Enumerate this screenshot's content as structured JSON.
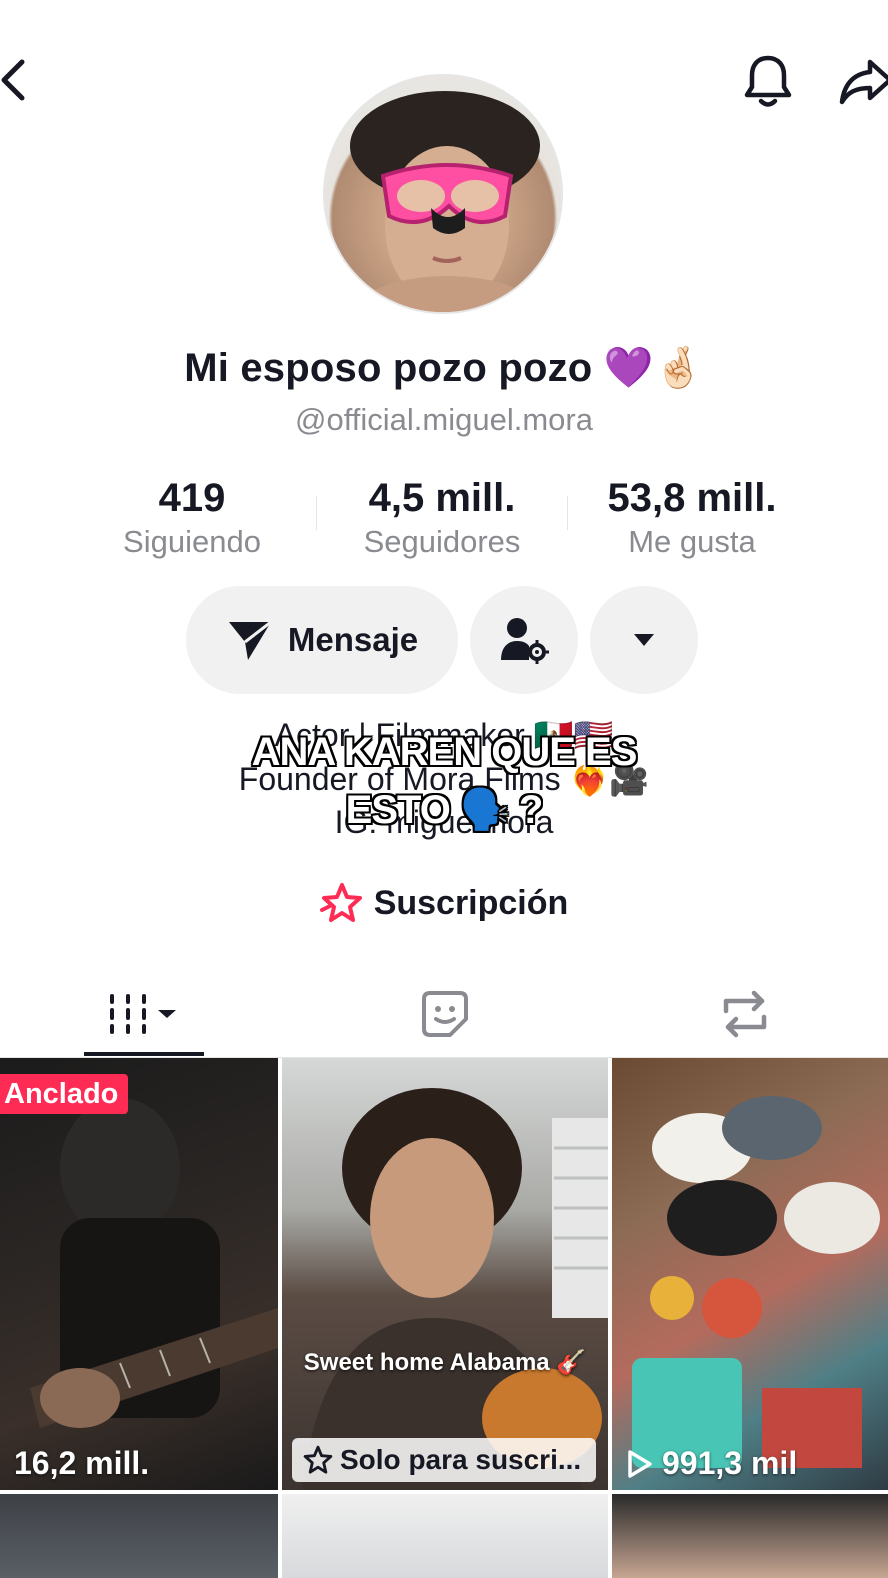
{
  "header": {
    "back_icon": "chevron-left-icon",
    "bell_icon": "bell-icon",
    "share_icon": "share-arrow-icon"
  },
  "profile": {
    "display_name": "Mi esposo pozo pozo 💜🤞🏻",
    "handle": "@official.miguel.mora"
  },
  "stats": [
    {
      "value": "419",
      "label": "Siguiendo"
    },
    {
      "value": "4,5 mill.",
      "label": "Seguidores"
    },
    {
      "value": "53,8 mill.",
      "label": "Me gusta"
    }
  ],
  "actions": {
    "message_label": "Mensaje",
    "message_icon": "send-icon",
    "friend_icon": "user-settings-icon",
    "more_icon": "caret-down-icon"
  },
  "bio": {
    "line1": "Actor | Filmmaker 🇲🇽🇺🇸",
    "line2": "Founder of Mora Films ❤️‍🔥🎥",
    "line3": "IG: miguelmora"
  },
  "caption_overlay": {
    "line1": "ANA KAREN QUE ES",
    "line2": "ESTO 🗣️ ?"
  },
  "subscription": {
    "label": "Suscripción",
    "icon": "star-outline-icon",
    "accent": "#fe2c55"
  },
  "tabs": [
    {
      "name": "videos",
      "icon": "grid-columns-icon"
    },
    {
      "name": "favorites",
      "icon": "sticker-icon"
    },
    {
      "name": "reposts",
      "icon": "repost-icon"
    }
  ],
  "videos": [
    {
      "badge": "Anclado",
      "views": "16,2 mill."
    },
    {
      "caption": "Sweet home Alabama 🎸",
      "lock_label": "Solo para suscri..."
    },
    {
      "views": "991,3 mil"
    }
  ]
}
